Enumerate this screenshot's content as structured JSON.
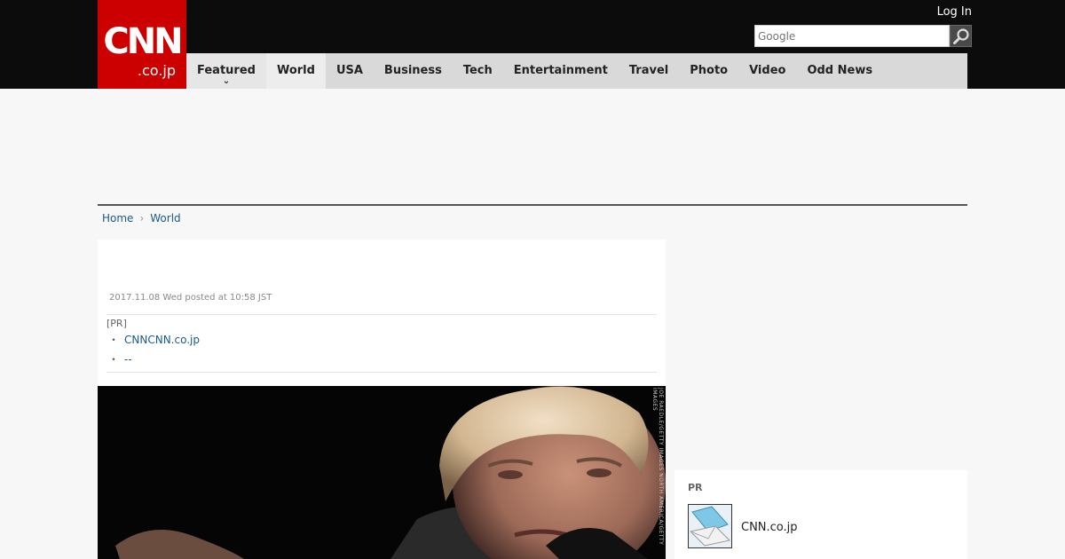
{
  "header": {
    "logo_main": "CNN",
    "logo_sub": ".co.jp",
    "login_label": "Log In",
    "search_placeholder": "Google",
    "nav": [
      {
        "label": "Featured"
      },
      {
        "label": "World"
      },
      {
        "label": "USA"
      },
      {
        "label": "Business"
      },
      {
        "label": "Tech"
      },
      {
        "label": "Entertainment"
      },
      {
        "label": "Travel"
      },
      {
        "label": "Photo"
      },
      {
        "label": "Video"
      },
      {
        "label": "Odd News"
      }
    ],
    "featured_caret": "⌄"
  },
  "breadcrumb": {
    "home": "Home",
    "section": "World",
    "separator": "›"
  },
  "article": {
    "posted": "2017.11.08 Wed posted at 10:58 JST",
    "pr_label": "[PR]",
    "pr_links": [
      {
        "text": "CNNCNN.co.jp"
      },
      {
        "text": "--"
      }
    ],
    "photo_credit": "JOE RAEDLE/GETTY IMAGES NORTH AMERICA/GETTY IMAGES"
  },
  "sidebar": {
    "pr_label": "PR",
    "pr_item_name": "CNN.co.jp"
  },
  "colors": {
    "brand_red": "#cc0000",
    "header_bg": "#0c0c0c",
    "nav_bg": "#d9d9d9",
    "link": "#1a5a8a"
  }
}
